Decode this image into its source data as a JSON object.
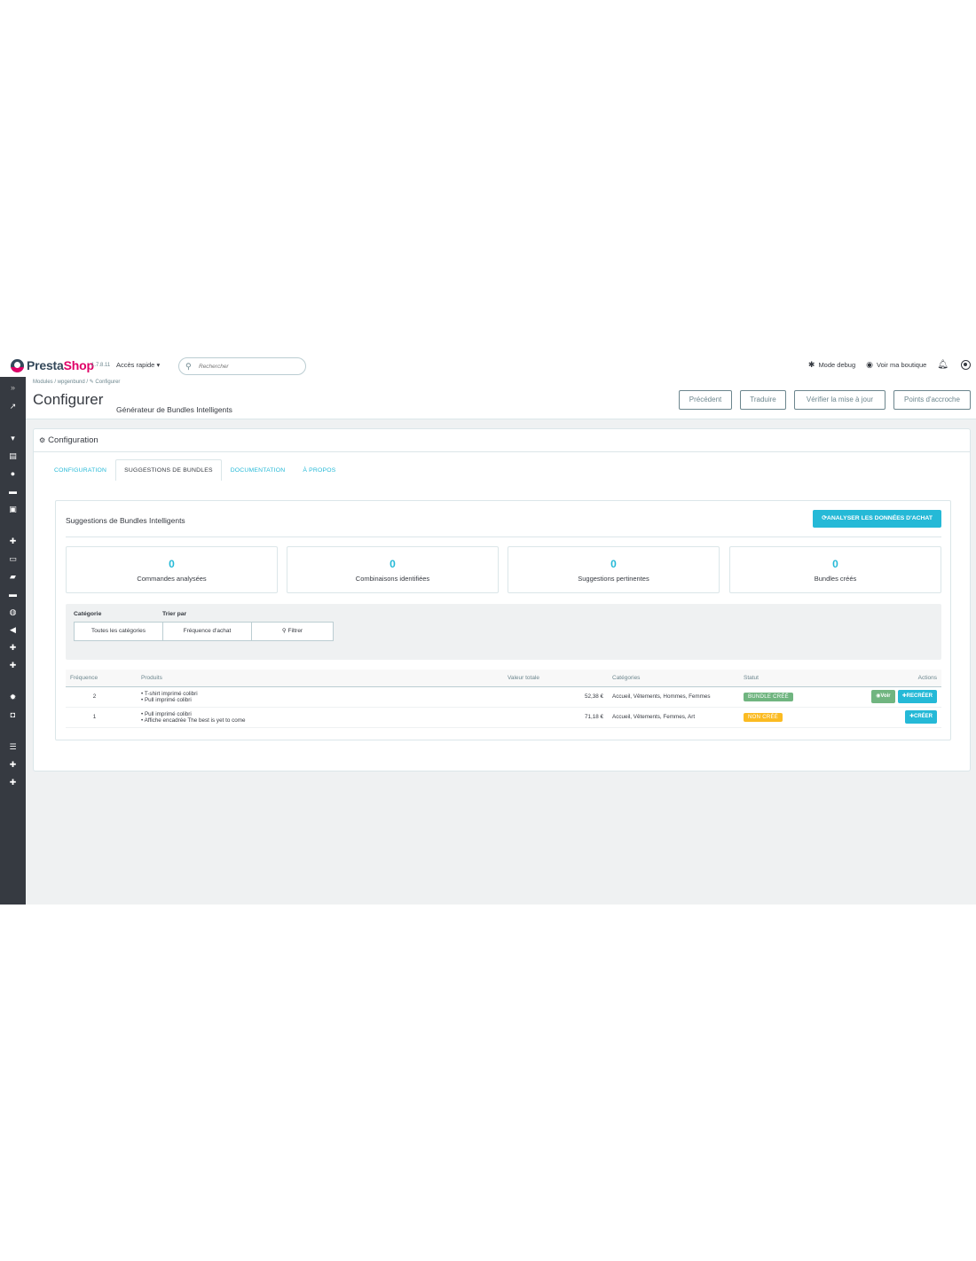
{
  "header": {
    "logo_presta": "Presta",
    "logo_shop": "Shop",
    "version": "1.7.8.11",
    "quick_access": "Accès rapide ▾",
    "search_placeholder": "Rechercher",
    "debug_label": "Mode debug",
    "view_shop_label": "Voir ma boutique"
  },
  "breadcrumb": "Modules  /  wpgenbund  /  ✎ Configurer",
  "page": {
    "title": "Configurer",
    "subtitle": "Générateur de Bundles Intelligents"
  },
  "toolbar": {
    "previous": "Précédent",
    "translate": "Traduire",
    "check_update": "Vérifier la mise à jour",
    "hooks": "Points d'accroche"
  },
  "panel": {
    "heading": "Configuration"
  },
  "tabs": [
    {
      "label": "CONFIGURATION"
    },
    {
      "label": "SUGGESTIONS DE BUNDLES"
    },
    {
      "label": "DOCUMENTATION"
    },
    {
      "label": "À PROPOS"
    }
  ],
  "card": {
    "title": "Suggestions de Bundles Intelligents",
    "analyze_button": "ANALYSER LES DONNÉES D'ACHAT"
  },
  "stats": [
    {
      "value": "0",
      "label": "Commandes analysées"
    },
    {
      "value": "0",
      "label": "Combinaisons identifiées"
    },
    {
      "value": "0",
      "label": "Suggestions pertinentes"
    },
    {
      "value": "0",
      "label": "Bundles créés"
    }
  ],
  "filters": {
    "category_label": "Catégorie",
    "sort_label": "Trier par",
    "category_value": "Toutes les catégories",
    "sort_value": "Fréquence d'achat",
    "filter_button": "Filtrer"
  },
  "table": {
    "headers": {
      "frequency": "Fréquence",
      "products": "Produits",
      "total": "Valeur totale",
      "categories": "Catégories",
      "status": "Statut",
      "actions": "Actions"
    },
    "rows": [
      {
        "frequency": "2",
        "product1": "• T-shirt imprimé colibri",
        "product2": "• Pull imprimé colibri",
        "total": "52,38 €",
        "categories": "Accueil, Vêtements, Hommes, Femmes",
        "status": "BUNDLE CRÉÉ",
        "view": "Voir",
        "action": "RECRÉER"
      },
      {
        "frequency": "1",
        "product1": "• Pull imprimé colibri",
        "product2": "• Affiche encadrée The best is yet to come",
        "total": "71,18 €",
        "categories": "Accueil, Vêtements, Femmes, Art",
        "status": "NON CRÉÉ",
        "action": "CRÉER"
      }
    ]
  },
  "colors": {
    "accent": "#25b9d7",
    "sidebar": "#363a41",
    "success": "#70b580",
    "warning": "#fbbb22",
    "brand_pink": "#df0067"
  }
}
